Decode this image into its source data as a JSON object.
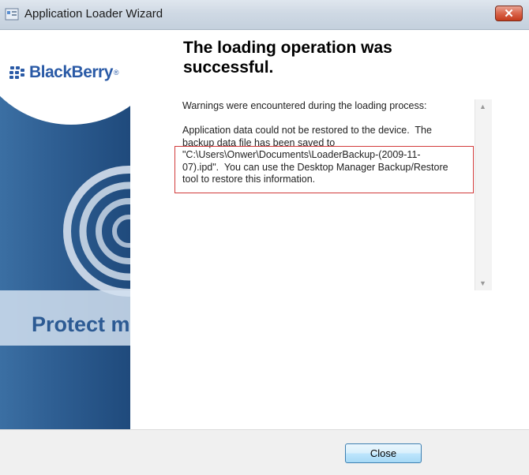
{
  "window": {
    "title": "Application Loader Wizard",
    "close_glyph": "✕"
  },
  "brand": {
    "logo_text": "BlackBerry",
    "logo_suffix": "®",
    "banner_text": "Protect m"
  },
  "content": {
    "heading": "The loading operation was successful.",
    "message_lines": [
      "Warnings were encountered during the loading process:",
      "",
      "Application data could not be restored to the device.  The",
      "backup data file has been saved to",
      "\"C:\\Users\\Onwer\\Documents\\LoaderBackup-(2009-11-",
      "07).ipd\".  You can use the Desktop Manager Backup/Restore",
      "tool to restore this information."
    ]
  },
  "buttons": {
    "close_label": "Close"
  },
  "colors": {
    "title_bar": "#cfd9e4",
    "close_button": "#d9644a",
    "highlight_border": "#d23a3a",
    "brand_blue": "#2a5aa6"
  },
  "icons": [
    "app-icon",
    "close-icon",
    "blackberry-logo-icon",
    "scroll-up-icon",
    "scroll-down-icon"
  ]
}
